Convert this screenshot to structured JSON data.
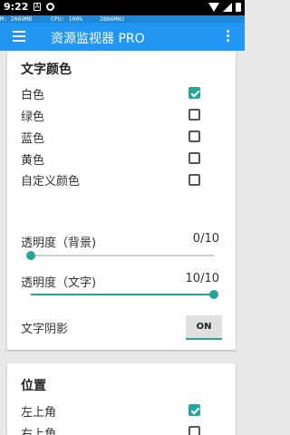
{
  "status_bar": {
    "time": "9:22",
    "notification_icons": [
      "a-icon",
      "ring-icon"
    ],
    "right_icons": [
      "wifi-icon",
      "cell-signal-icon",
      "battery-icon"
    ]
  },
  "monitor_overlay": {
    "memory": "M: 2069MB",
    "cpu": "CPU: 100%",
    "freq": "2866MHz"
  },
  "app_bar": {
    "title": "资源监视器 PRO",
    "accent": "#2196f3"
  },
  "text_color_section": {
    "title": "文字颜色",
    "options": [
      {
        "label": "白色",
        "checked": true
      },
      {
        "label": "绿色",
        "checked": false
      },
      {
        "label": "蓝色",
        "checked": false
      },
      {
        "label": "黄色",
        "checked": false
      },
      {
        "label": "自定义颜色",
        "checked": false
      }
    ]
  },
  "opacity_background": {
    "label": "透明度（背景)",
    "value_text": "0/10",
    "value": 0,
    "max": 10
  },
  "opacity_text": {
    "label": "透明度（文字)",
    "value_text": "10/10",
    "value": 10,
    "max": 10
  },
  "text_shadow": {
    "label": "文字阴影",
    "toggle_label": "ON",
    "on": true
  },
  "position_section": {
    "title": "位置",
    "options": [
      {
        "label": "左上角",
        "checked": true
      },
      {
        "label": "右上角",
        "checked": false
      }
    ]
  },
  "colors": {
    "teal_accent": "#26a69a"
  }
}
